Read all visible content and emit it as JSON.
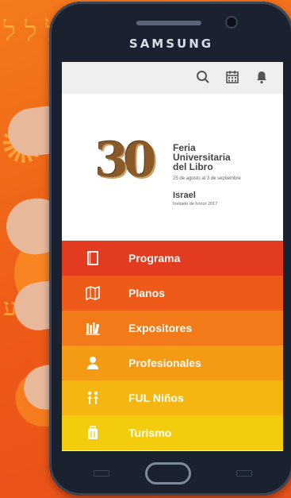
{
  "device": {
    "brand": "SAMSUNG"
  },
  "topbar": {
    "icons": [
      "search-icon",
      "calendar-icon",
      "bell-icon"
    ]
  },
  "hero": {
    "logo_number": "30",
    "title_line1": "Feria",
    "title_line2": "Universitaria",
    "title_line3": "del Libro",
    "dates": "25 de agosto al 3 de septiembre",
    "guest_country": "Israel",
    "guest_note": "Invitado de honor 2017"
  },
  "menu": {
    "items": [
      {
        "label": "Programa",
        "icon": "book-icon",
        "color": "#e33b1f"
      },
      {
        "label": "Planos",
        "icon": "map-icon",
        "color": "#ee5b19"
      },
      {
        "label": "Expositores",
        "icon": "books-icon",
        "color": "#f27a18"
      },
      {
        "label": "Profesionales",
        "icon": "person-icon",
        "color": "#f59a15"
      },
      {
        "label": "FUL Niños",
        "icon": "children-icon",
        "color": "#f5b611"
      },
      {
        "label": "Turismo",
        "icon": "luggage-icon",
        "color": "#f4cc0e"
      }
    ]
  }
}
